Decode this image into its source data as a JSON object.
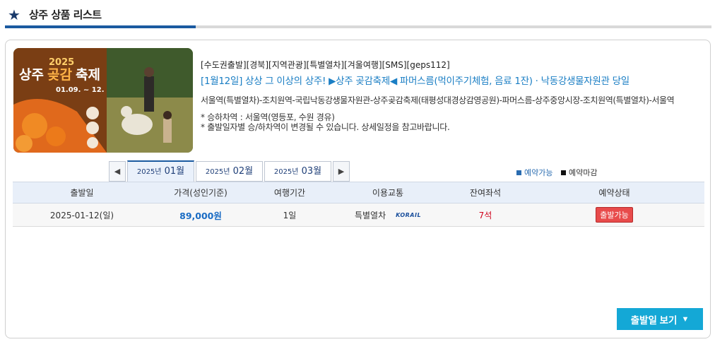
{
  "header": {
    "title": "상주 상품 리스트"
  },
  "product": {
    "thumbnail": {
      "year": "2025",
      "title_a": "상주",
      "title_b": "곶감",
      "title_c": "축제",
      "dates": "01.09. ~ 12."
    },
    "tags": "[수도권출발][경북][지역관광][특별열차][겨울여행][SMS][geps112]",
    "headline": "[1월12일] 상상 그 이상의 상주! ▶상주 곶감축제◀ 파머스름(먹이주기체험, 음료 1잔) · 낙동강생물자원관 당일",
    "route": "서울역(특별열차)-조치원역-국립낙동강생물자원관-상주곶감축제(태평성대경상감영공원)-파머스름-상주중앙시장-조치원역(특별열차)-서울역",
    "notes": [
      "* 승하차역 : 서울역(영등포, 수원 경유)",
      "* 출발일자별 승/하차역이 변경될 수 있습니다. 상세일정을 참고바랍니다."
    ]
  },
  "months": {
    "prev_icon": "◀",
    "next_icon": "▶",
    "tabs": [
      {
        "year": "2025년",
        "month": "01월",
        "active": true
      },
      {
        "year": "2025년",
        "month": "02월",
        "active": false
      },
      {
        "year": "2025년",
        "month": "03월",
        "active": false
      }
    ]
  },
  "legend": {
    "available": "예약가능",
    "closed": "예약마감",
    "available_color": "#2a6cb0",
    "closed_color": "#111111"
  },
  "table": {
    "columns": [
      "출발일",
      "가격(성인기준)",
      "여행기간",
      "이용교통",
      "잔여좌석",
      "예약상태"
    ],
    "rows": [
      {
        "date": "2025-01-12(일)",
        "price": "89,000원",
        "duration": "1일",
        "transport": "특별열차",
        "transport_logo": "KORAIL",
        "seats": "7석",
        "status": "출발가능"
      }
    ]
  },
  "footer": {
    "depart_button": "출발일 보기",
    "depart_icon": "▼"
  }
}
